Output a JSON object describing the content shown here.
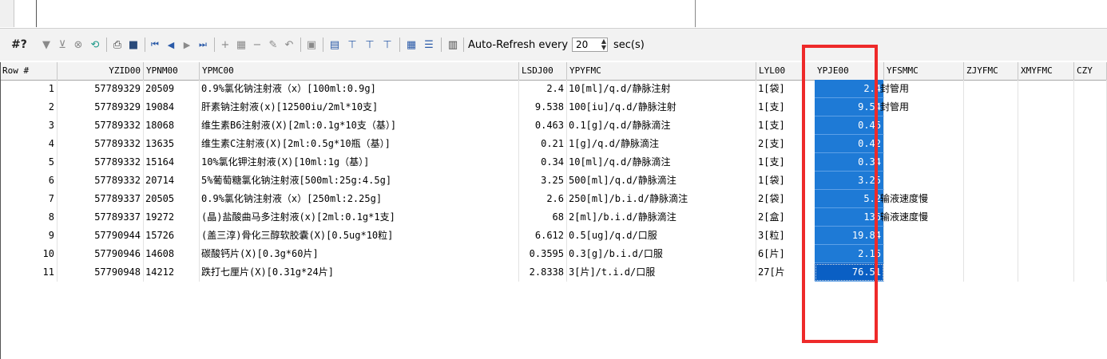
{
  "toolbar": {
    "hash": "#?",
    "refresh_label": "Auto-Refresh every",
    "refresh_value": "20",
    "refresh_unit": "sec(s)"
  },
  "columns": [
    "Row #",
    "YZID00",
    "YPNM00",
    "YPMC00",
    "LSDJ00",
    "YPYFMC",
    "LYL00",
    "YPJE00",
    "YFSMMC",
    "ZJYFMC",
    "XMYFMC",
    "CZY"
  ],
  "rows": [
    {
      "row": "1",
      "yzid": "57789329",
      "ypnm": "20509",
      "ypmc": "0.9%氯化钠注射液（x）[100ml:0.9g]",
      "lsdj": "2.4",
      "ypyf": "10[ml]/q.d/静脉注射",
      "lyl": "1[袋]",
      "ypje": "2.4",
      "yfsm": "封管用"
    },
    {
      "row": "2",
      "yzid": "57789329",
      "ypnm": "19084",
      "ypmc": "肝素钠注射液(x)[12500iu/2ml*10支]",
      "lsdj": "9.538",
      "ypyf": "100[iu]/q.d/静脉注射",
      "lyl": "1[支]",
      "ypje": "9.54",
      "yfsm": "封管用"
    },
    {
      "row": "3",
      "yzid": "57789332",
      "ypnm": "18068",
      "ypmc": "维生素B6注射液(X)[2ml:0.1g*10支（基）]",
      "lsdj": "0.463",
      "ypyf": "0.1[g]/q.d/静脉滴注",
      "lyl": "1[支]",
      "ypje": "0.46",
      "yfsm": ""
    },
    {
      "row": "4",
      "yzid": "57789332",
      "ypnm": "13635",
      "ypmc": "维生素C注射液(X)[2ml:0.5g*10瓶（基）]",
      "lsdj": "0.21",
      "ypyf": "1[g]/q.d/静脉滴注",
      "lyl": "2[支]",
      "ypje": "0.42",
      "yfsm": ""
    },
    {
      "row": "5",
      "yzid": "57789332",
      "ypnm": "15164",
      "ypmc": "10%氯化钾注射液(X)[10ml:1g（基）]",
      "lsdj": "0.34",
      "ypyf": "10[ml]/q.d/静脉滴注",
      "lyl": "1[支]",
      "ypje": "0.34",
      "yfsm": ""
    },
    {
      "row": "6",
      "yzid": "57789332",
      "ypnm": "20714",
      "ypmc": "5%葡萄糖氯化钠注射液[500ml:25g:4.5g]",
      "lsdj": "3.25",
      "ypyf": "500[ml]/q.d/静脉滴注",
      "lyl": "1[袋]",
      "ypje": "3.25",
      "yfsm": ""
    },
    {
      "row": "7",
      "yzid": "57789337",
      "ypnm": "20505",
      "ypmc": "0.9%氯化钠注射液（x）[250ml:2.25g]",
      "lsdj": "2.6",
      "ypyf": "250[ml]/b.i.d/静脉滴注",
      "lyl": "2[袋]",
      "ypje": "5.2",
      "yfsm": "输液速度慢"
    },
    {
      "row": "8",
      "yzid": "57789337",
      "ypnm": "19272",
      "ypmc": "(晶)盐酸曲马多注射液(x)[2ml:0.1g*1支]",
      "lsdj": "68",
      "ypyf": "2[ml]/b.i.d/静脉滴注",
      "lyl": "2[盒]",
      "ypje": "136",
      "yfsm": "输液速度慢"
    },
    {
      "row": "9",
      "yzid": "57790944",
      "ypnm": "15726",
      "ypmc": "(盖三淳)骨化三醇软胶囊(X)[0.5ug*10粒]",
      "lsdj": "6.612",
      "ypyf": "0.5[ug]/q.d/口服",
      "lyl": "3[粒]",
      "ypje": "19.84",
      "yfsm": ""
    },
    {
      "row": "10",
      "yzid": "57790946",
      "ypnm": "14608",
      "ypmc": "碳酸钙片(X)[0.3g*60片]",
      "lsdj": "0.3595",
      "ypyf": "0.3[g]/b.i.d/口服",
      "lyl": "6[片]",
      "ypje": "2.16",
      "yfsm": ""
    },
    {
      "row": "11",
      "yzid": "57790948",
      "ypnm": "14212",
      "ypmc": "跌打七厘片(X)[0.31g*24片]",
      "lsdj": "2.8338",
      "ypyf": "3[片]/t.i.d/口服",
      "lyl": "27[片",
      "ypje": "76.51",
      "yfsm": ""
    }
  ]
}
